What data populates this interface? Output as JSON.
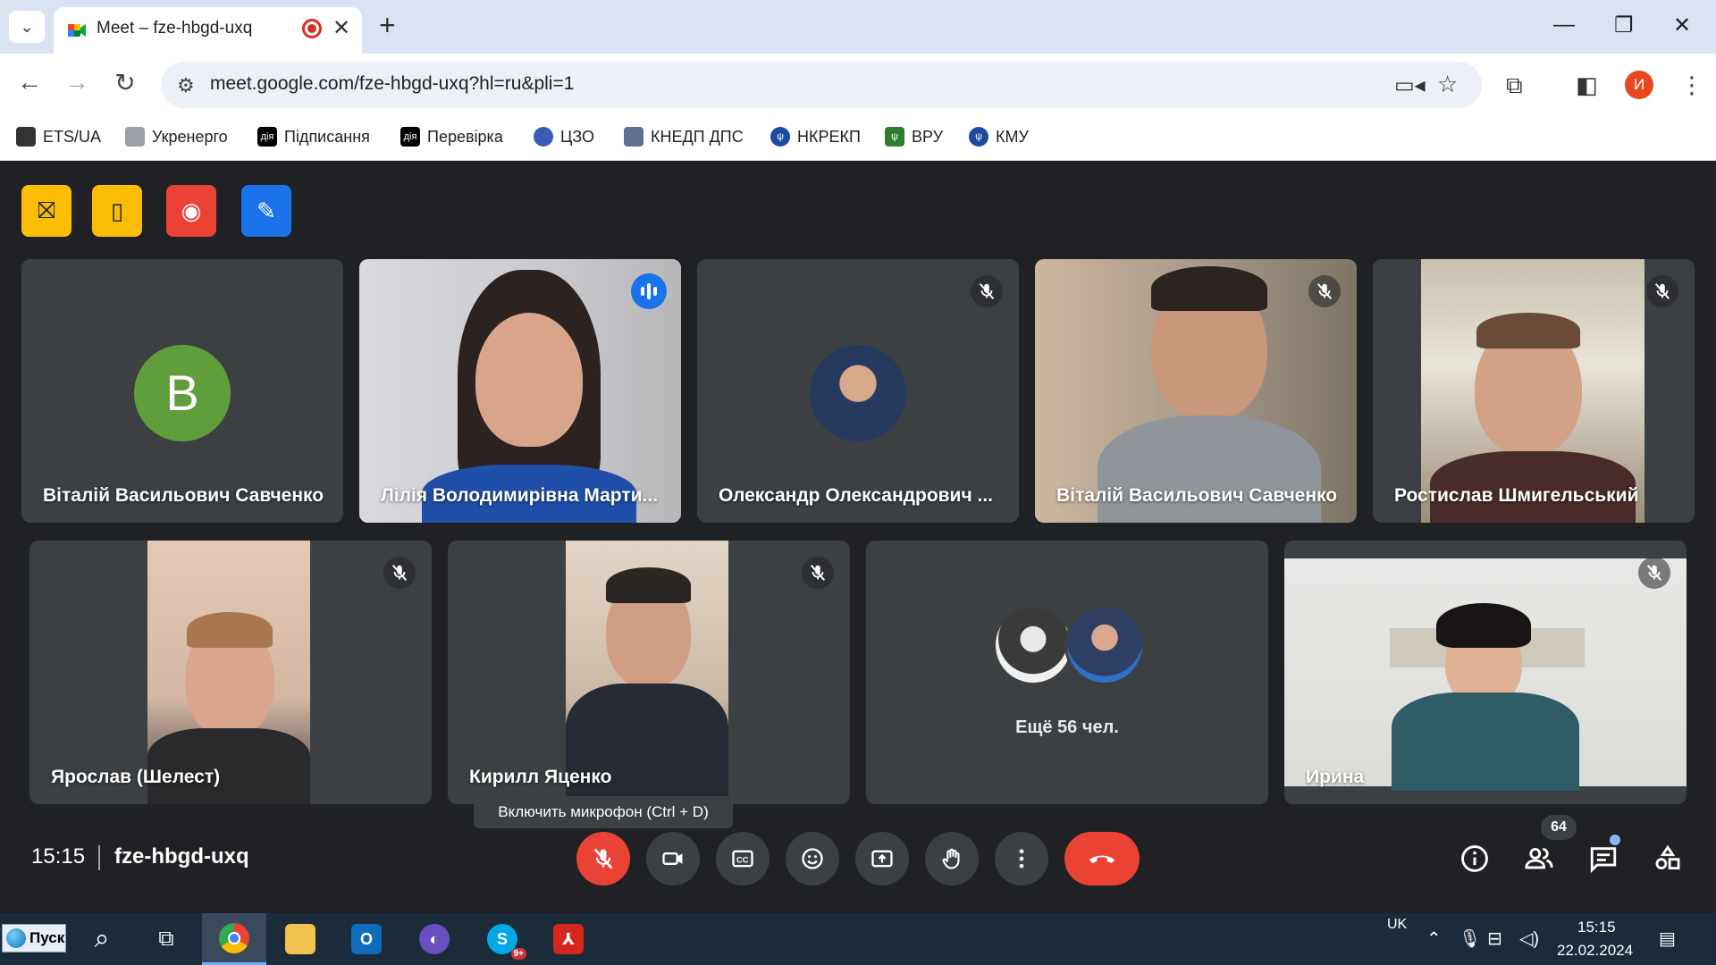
{
  "browser": {
    "tab_title": "Meet – fze-hbgd-uxq",
    "url": "meet.google.com/fze-hbgd-uxq?hl=ru&pli=1",
    "profile_initial": "И",
    "new_tab_glyph": "+",
    "close_glyph": "✕",
    "bookmarks": [
      {
        "label": "ETS/UA",
        "icon": "ets-icon",
        "color": "#333333"
      },
      {
        "label": "Укренерго",
        "icon": "document-icon",
        "color": "#9aa0a6"
      },
      {
        "label": "Підписання",
        "icon": "diia-icon",
        "color": "#000000"
      },
      {
        "label": "Перевірка",
        "icon": "diia-icon",
        "color": "#000000"
      },
      {
        "label": "ЦЗО",
        "icon": "czo-icon",
        "color": "#3b5bb5"
      },
      {
        "label": "КНЕДП ДПС",
        "icon": "kep-icon",
        "color": "#5f6f8f"
      },
      {
        "label": "НКРЕКП",
        "icon": "trident-icon",
        "color": "#1e4aa0"
      },
      {
        "label": "ВРУ",
        "icon": "trident-icon",
        "color": "#2e7d32"
      },
      {
        "label": "КМУ",
        "icon": "trident-icon",
        "color": "#1e4aa0"
      }
    ]
  },
  "meet": {
    "participants_row1": [
      {
        "name": "Віталій Васильович Савченко",
        "type": "letter",
        "letter": "В",
        "muted": true
      },
      {
        "name": "Лілія Володимирівна Марти...",
        "type": "video",
        "speaking": true
      },
      {
        "name": "Олександр Олександрович ...",
        "type": "photo",
        "muted": true
      },
      {
        "name": "Віталій Васильович Савченко",
        "type": "video",
        "muted": true
      },
      {
        "name": "Ростислав Шмигельський",
        "type": "video",
        "muted": true
      }
    ],
    "participants_row2": [
      {
        "name": "Ярослав (Шелест)",
        "type": "video",
        "muted": true
      },
      {
        "name": "Кирилл Яценко",
        "type": "video",
        "muted": true
      },
      {
        "name": "",
        "type": "others",
        "others_label": "Ещё 56 чел."
      },
      {
        "name": "Ирина",
        "type": "video",
        "muted": true
      }
    ],
    "tooltip": "Включить микрофон (Ctrl + D)",
    "clock": "15:15",
    "meeting_code": "fze-hbgd-uxq",
    "people_count": "64",
    "colors": {
      "accent": "#8ab4f8",
      "danger": "#ea4335",
      "tile_bg": "#3c4043",
      "top_yellow": "#fbbc04",
      "top_red": "#ea4335",
      "top_blue": "#1a73e8"
    }
  },
  "taskbar": {
    "start_label": "Пуск",
    "lang": "UK",
    "time": "15:15",
    "date": "22.02.2024",
    "skype_badge": "9+"
  }
}
